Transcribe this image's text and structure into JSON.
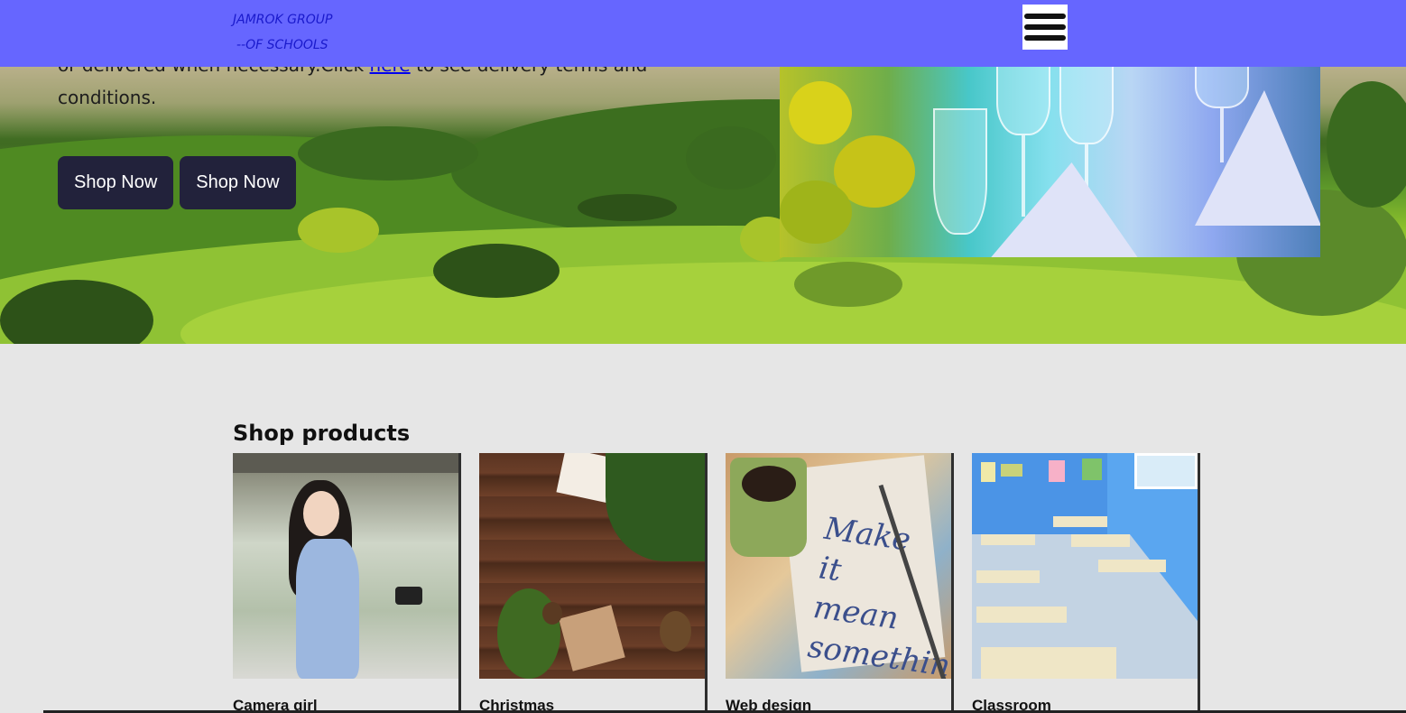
{
  "header": {
    "logo_line1": "JAMROK GROUP",
    "logo_line2": "--OF SCHOOLS",
    "menu_icon": "hamburger-menu-icon",
    "background_color": "#6666ff"
  },
  "hero": {
    "text_before_link": "or delivered when necessary.Click ",
    "link_text": "here",
    "text_after_link": " to see delivery terms and conditions.",
    "buttons": [
      {
        "label": "Shop Now"
      },
      {
        "label": "Shop Now"
      }
    ]
  },
  "shop": {
    "title": "Shop products",
    "products": [
      {
        "name": "Camera girl"
      },
      {
        "name": "Christmas"
      },
      {
        "name": "Web design"
      },
      {
        "name": "Classroom"
      }
    ]
  },
  "web_design_card": {
    "text_l1": "Make it",
    "text_l2": "mean",
    "text_l3": "something"
  }
}
